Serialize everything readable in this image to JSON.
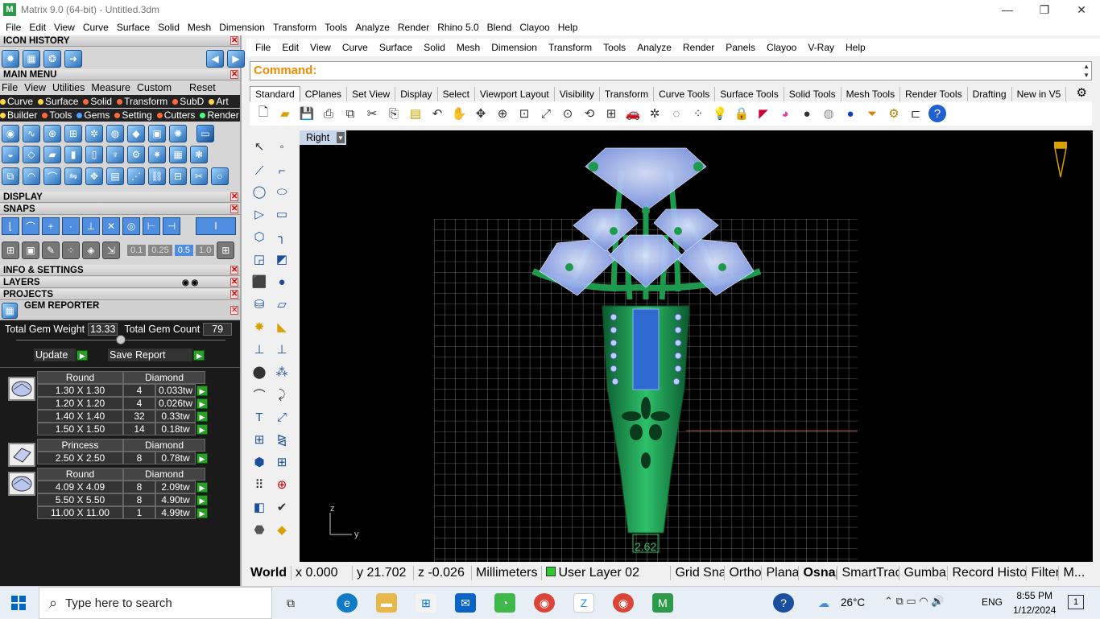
{
  "app": {
    "title": "Matrix 9.0 (64-bit) - Untitled.3dm",
    "logo_text": "M",
    "minimize": "—",
    "restore": "❐",
    "close": "✕"
  },
  "menu1": [
    "File",
    "Edit",
    "View",
    "Curve",
    "Surface",
    "Solid",
    "Mesh",
    "Dimension",
    "Transform",
    "Tools",
    "Analyze",
    "Render",
    "Rhino 5.0",
    "Blend",
    "Clayoo",
    "Help"
  ],
  "left": {
    "icon_history": "ICON HISTORY",
    "main_menu": "MAIN MENU",
    "mm_menu": [
      "File",
      "View",
      "Utilities",
      "Measure",
      "Custom"
    ],
    "mm_reset": "Reset",
    "mm_row1": [
      {
        "label": "Curve",
        "color": "#ffd84a"
      },
      {
        "label": "Surface",
        "color": "#ffd84a"
      },
      {
        "label": "Solid",
        "color": "#ff6a3a"
      },
      {
        "label": "Transform",
        "color": "#ff6a3a"
      },
      {
        "label": "SubD",
        "color": "#ff6a3a"
      },
      {
        "label": "Art",
        "color": "#ffd84a"
      }
    ],
    "mm_row2": [
      {
        "label": "Builder",
        "color": "#ffd84a"
      },
      {
        "label": "Tools",
        "color": "#ff6a3a"
      },
      {
        "label": "Gems",
        "color": "#4aa3ff"
      },
      {
        "label": "Setting",
        "color": "#ff6a3a"
      },
      {
        "label": "Cutters",
        "color": "#ff6a3a"
      },
      {
        "label": "Render",
        "color": "#4aff7a"
      }
    ],
    "display": "DISPLAY",
    "snaps": "SNAPS",
    "snap_values": [
      "0.1",
      "0.25",
      "0.5",
      "1.0"
    ],
    "info": "INFO & SETTINGS",
    "layers": "LAYERS",
    "projects": "PROJECTS",
    "gem_reporter": "GEM REPORTER",
    "total_weight_label": "Total Gem Weight",
    "total_weight": "13.33",
    "total_count_label": "Total Gem Count",
    "total_count": "79",
    "update": "Update",
    "save_report": "Save Report",
    "go": "▶",
    "groups": [
      {
        "shape": "Round",
        "material": "Diamond",
        "rows": [
          {
            "size": "1.30 X 1.30",
            "qty": "4",
            "wt": "0.033tw"
          },
          {
            "size": "1.20 X 1.20",
            "qty": "4",
            "wt": "0.026tw"
          },
          {
            "size": "1.40 X 1.40",
            "qty": "32",
            "wt": "0.33tw"
          },
          {
            "size": "1.50 X 1.50",
            "qty": "14",
            "wt": "0.18tw"
          }
        ]
      },
      {
        "shape": "Princess",
        "material": "Diamond",
        "rows": [
          {
            "size": "2.50 X 2.50",
            "qty": "8",
            "wt": "0.78tw"
          }
        ]
      },
      {
        "shape": "Round",
        "material": "Diamond",
        "rows": [
          {
            "size": "4.09 X 4.09",
            "qty": "8",
            "wt": "2.09tw"
          },
          {
            "size": "5.50 X 5.50",
            "qty": "8",
            "wt": "4.90tw"
          },
          {
            "size": "11.00 X 11.00",
            "qty": "1",
            "wt": "4.99tw"
          }
        ]
      }
    ]
  },
  "rhino_menu": [
    "File",
    "Edit",
    "View",
    "Curve",
    "Surface",
    "Solid",
    "Mesh",
    "Dimension",
    "Transform",
    "Tools",
    "Analyze",
    "Render",
    "Panels",
    "Clayoo",
    "V-Ray",
    "Help"
  ],
  "command_label": "Command:",
  "tabs": [
    "Standard",
    "CPlanes",
    "Set View",
    "Display",
    "Select",
    "Viewport Layout",
    "Visibility",
    "Transform",
    "Curve Tools",
    "Surface Tools",
    "Solid Tools",
    "Mesh Tools",
    "Render Tools",
    "Drafting",
    "New in V5"
  ],
  "viewport": {
    "name": "Right",
    "dimension": "2.62",
    "axis_z": "z",
    "axis_y": "y"
  },
  "status": {
    "world": "World",
    "x": "x 0.000",
    "y": "y 21.702",
    "z": "z -0.026",
    "units": "Millimeters",
    "layer": "User Layer 02",
    "items": [
      "Grid Snap",
      "Ortho",
      "Planar",
      "Osnap",
      "SmartTrack",
      "Gumball",
      "Record History",
      "Filter",
      "M..."
    ]
  },
  "taskbar": {
    "search": "Type here to search",
    "temp": "26°C",
    "lang": "ENG",
    "time": "8:55 PM",
    "date": "1/12/2024",
    "notif": "1"
  }
}
